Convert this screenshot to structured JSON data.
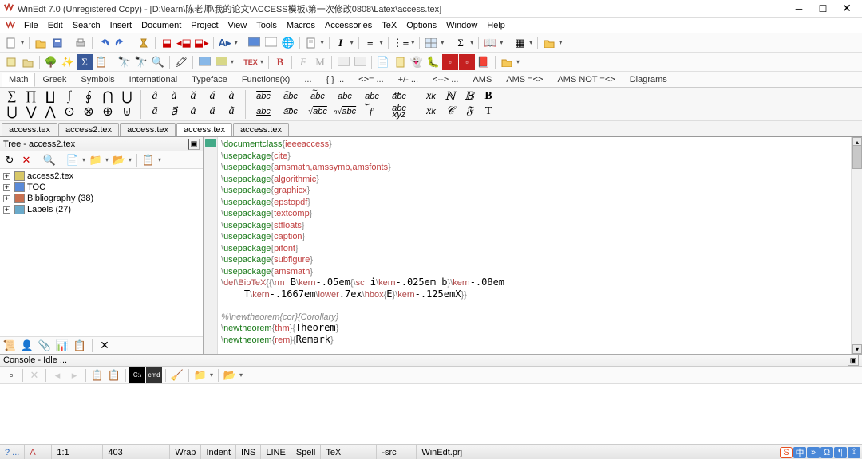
{
  "title": "WinEdt 7.0  (Unregistered Copy) - [D:\\learn\\陈老师\\我的论文\\ACCESS模板\\第一次修改0808\\Latex\\access.tex]",
  "menus": [
    "File",
    "Edit",
    "Search",
    "Insert",
    "Document",
    "Project",
    "View",
    "Tools",
    "Macros",
    "Accessories",
    "TeX",
    "Options",
    "Window",
    "Help"
  ],
  "subtabs": [
    "Math",
    "Greek",
    "Symbols",
    "International",
    "Typeface",
    "Functions(x)",
    "...",
    "{ }  ...",
    "<>= ...",
    "+/- ...",
    "<--> ...",
    "AMS",
    "AMS  =<>",
    "AMS NOT =<>",
    "Diagrams"
  ],
  "filetabs": [
    "access.tex",
    "access2.tex",
    "access.tex",
    "access.tex",
    "access.tex"
  ],
  "active_filetab": 3,
  "active_subtab": 0,
  "tree": {
    "title": "Tree - access2.tex",
    "items": [
      {
        "label": "access2.tex",
        "icon": "doc",
        "exp": "+"
      },
      {
        "label": "TOC",
        "icon": "toc",
        "exp": "+"
      },
      {
        "label": "Bibliography  (38)",
        "icon": "bib",
        "exp": "+"
      },
      {
        "label": "Labels  (27)",
        "icon": "lab",
        "exp": "+"
      }
    ]
  },
  "code_lines": [
    {
      "t": "cmd",
      "pre": "\\",
      "cmd": "documentclass",
      "arg": "ieeeaccess"
    },
    {
      "t": "cmd",
      "pre": "\\",
      "cmd": "usepackage",
      "arg": "cite"
    },
    {
      "t": "cmd",
      "pre": "\\",
      "cmd": "usepackage",
      "arg": "amsmath,amssymb,amsfonts"
    },
    {
      "t": "cmd",
      "pre": "\\",
      "cmd": "usepackage",
      "arg": "algorithmic"
    },
    {
      "t": "cmd",
      "pre": "\\",
      "cmd": "usepackage",
      "arg": "graphicx"
    },
    {
      "t": "cmd",
      "pre": "\\",
      "cmd": "usepackage",
      "arg": "epstopdf"
    },
    {
      "t": "cmd",
      "pre": "\\",
      "cmd": "usepackage",
      "arg": "textcomp"
    },
    {
      "t": "cmd",
      "pre": "\\",
      "cmd": "usepackage",
      "arg": "stfloats"
    },
    {
      "t": "cmd",
      "pre": "\\",
      "cmd": "usepackage",
      "arg": "caption"
    },
    {
      "t": "cmd",
      "pre": "\\",
      "cmd": "usepackage",
      "arg": "pifont"
    },
    {
      "t": "cmd",
      "pre": "\\",
      "cmd": "usepackage",
      "arg": "subfigure"
    },
    {
      "t": "cmd",
      "pre": "\\",
      "cmd": "usepackage",
      "arg": "amsmath"
    },
    {
      "t": "raw",
      "text": "\\def\\BibTeX{{\\rm B\\kern-.05em{\\sc i\\kern-.025em b}\\kern-.08em"
    },
    {
      "t": "raw",
      "text": "    T\\kern-.1667em\\lower.7ex\\hbox{E}\\kern-.125emX}}"
    },
    {
      "t": "blank"
    },
    {
      "t": "comm",
      "text": "%\\newtheorem{cor}{Corollary}"
    },
    {
      "t": "nt",
      "cmd": "newtheorem",
      "a1": "thm",
      "a2": "Theorem"
    },
    {
      "t": "nt",
      "cmd": "newtheorem",
      "a1": "rem",
      "a2": "Remark"
    }
  ],
  "console": {
    "title": "Console - Idle ..."
  },
  "status": {
    "q": "? ...",
    "a": "A",
    "pos": "1:1",
    "lines": "403",
    "wrap": "Wrap",
    "indent": "Indent",
    "ins": "INS",
    "line": "LINE",
    "spell": "Spell",
    "tex": "TeX",
    "src": "-src",
    "prj": "WinEdt.prj"
  },
  "status_icons": [
    "S",
    "中",
    "»",
    "Ω",
    "¶",
    "⟟"
  ]
}
